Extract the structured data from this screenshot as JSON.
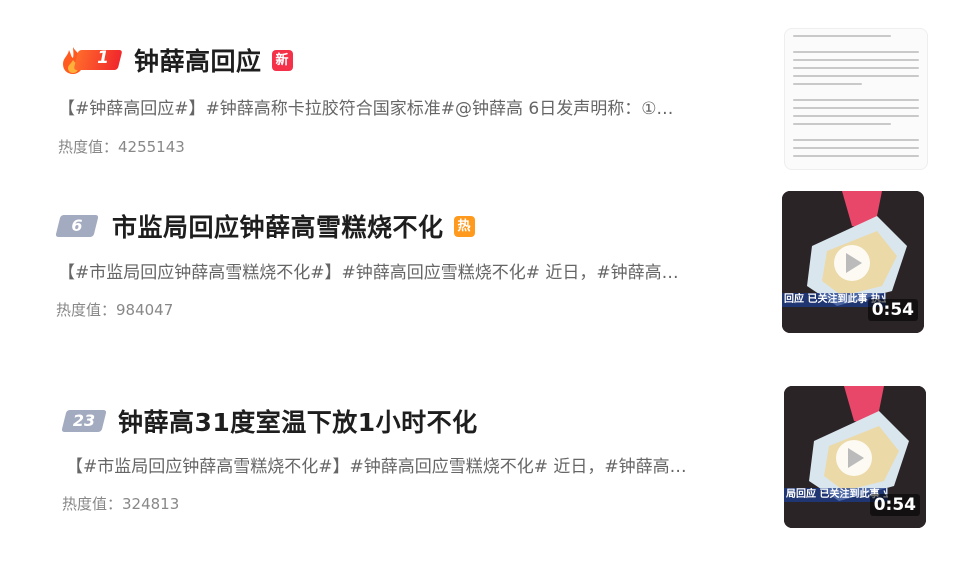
{
  "items": [
    {
      "rank": "1",
      "title": "钟薛高回应",
      "tag": "新",
      "summary": "【#钟薛高回应#】#钟薛高称卡拉胶符合国家标准#@钟薛高 6日发声明称：①…",
      "heat": "热度值：4255143",
      "thumbnail": "document-preview"
    },
    {
      "rank": "6",
      "title": "市监局回应钟薛高雪糕烧不化",
      "tag": "热",
      "summary": "【#市监局回应钟薛高雪糕烧不化#】#钟薛高回应雪糕烧不化# 近日，#钟薛高…",
      "heat": "热度值：984047",
      "thumbnail": "video",
      "video_caption": "回应 已关注到此事\n执业务处室",
      "duration": "0:54"
    },
    {
      "rank": "23",
      "title": "钟薛高31度室温下放1小时不化",
      "tag": "",
      "summary": "【#市监局回应钟薛高雪糕烧不化#】#钟薛高回应雪糕烧不化# 近日，#钟薛高…",
      "heat": "热度值：324813",
      "thumbnail": "video",
      "video_caption": "局回应 已关注到此事\n业务处室",
      "duration": "0:54"
    }
  ],
  "colors": {
    "top_rank_gradient": [
      "#ff6a2b",
      "#f1272c"
    ],
    "rank_badge": "#a3abc0",
    "new_tag": "#f5314a",
    "hot_tag": "#ff9a1f",
    "title": "#1e1e1e",
    "summary": "#666666",
    "heat": "#888888"
  },
  "icons": {
    "top_rank": "fire-icon",
    "video_play": "play-icon"
  }
}
